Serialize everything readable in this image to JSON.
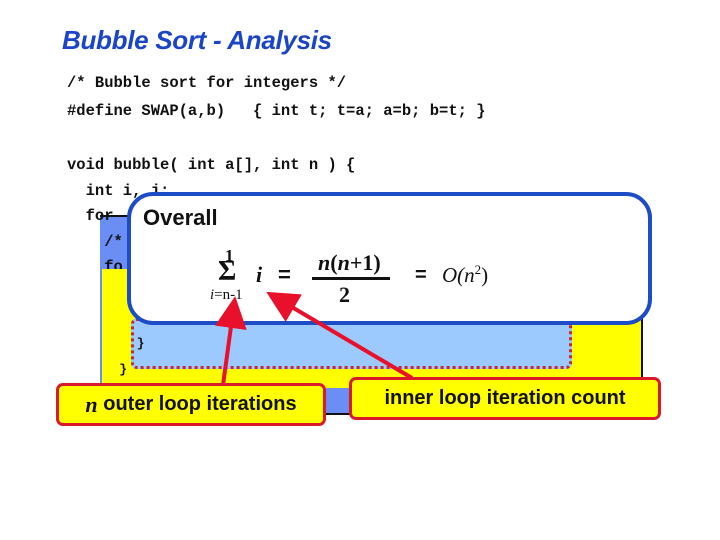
{
  "slide": {
    "title": "Bubble Sort - Analysis",
    "code_lines": [
      "/* Bubble sort for integers */",
      "#define SWAP(a,b)   { int t; t=a; a=b; b=t; }",
      "",
      "void bubble( int a[], int n ) {",
      "  int i, j;",
      "  for",
      "    /*",
      "    fo",
      "",
      "",
      "",
      "      }",
      "    }"
    ],
    "overall_box": {
      "title": "Overall",
      "formula": {
        "sum_symbol": "Σ",
        "sum_upper": "1",
        "sum_lower_var": "i",
        "sum_lower_rest": "=n-1",
        "summand": "i",
        "equals1": "=",
        "numerator_n": "n",
        "numerator_rest_open": "(",
        "numerator_n2": "n",
        "numerator_rest_close": "+1)",
        "denominator": "2",
        "equals2": "=",
        "big_o_prefix": "O(",
        "big_o_var": "n",
        "big_o_exp": "2",
        "big_o_suffix": ")"
      }
    },
    "callouts": {
      "outer": {
        "var": "n",
        "text": " outer loop iterations"
      },
      "inner": {
        "text": "inner loop iteration count"
      }
    },
    "colors": {
      "title": "#1b45c8",
      "outer_loop": "#6a8ef4",
      "inner_loop": "#ffff00",
      "body": "#9ccaff",
      "callout_border": "#d91a2a",
      "overall_border": "#1d4cc7"
    }
  }
}
